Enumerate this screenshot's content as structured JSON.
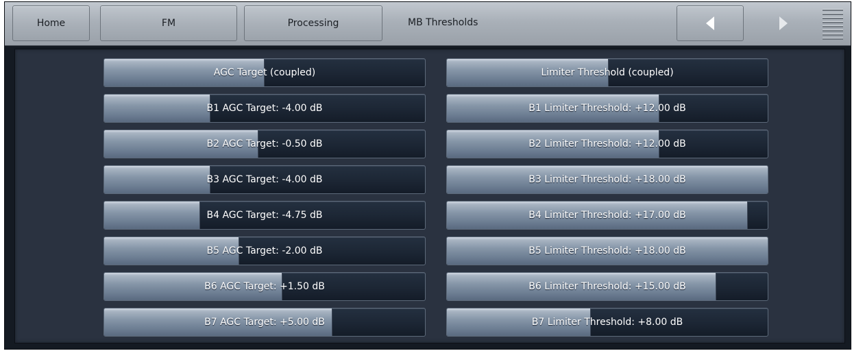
{
  "nav": {
    "home": "Home",
    "fm": "FM",
    "processing": "Processing",
    "page_title": "MB Thresholds",
    "prev_icon": "triangle-left",
    "next_icon": "triangle-right",
    "menu_icon": "hamburger"
  },
  "colors": {
    "frame": "#141a22",
    "panel": "#2a3240",
    "nav_bar": "#a9b0b8",
    "button_fill": "#8696a8",
    "button_track": "#1c2634",
    "text": "#ffffff"
  },
  "agc_buttons": [
    {
      "label": "AGC Target (coupled)",
      "level": 0.497
    },
    {
      "label": "B1 AGC Target: -4.00 dB",
      "level": 0.33
    },
    {
      "label": "B2 AGC Target: -0.50 dB",
      "level": 0.479
    },
    {
      "label": "B3 AGC Target: -4.00 dB",
      "level": 0.33
    },
    {
      "label": "B4 AGC Target: -4.75 dB",
      "level": 0.298
    },
    {
      "label": "B5 AGC Target: -2.00 dB",
      "level": 0.419
    },
    {
      "label": "B6 AGC Target: +1.50 dB",
      "level": 0.553
    },
    {
      "label": "B7 AGC Target: +5.00 dB",
      "level": 0.709
    }
  ],
  "limiter_buttons": [
    {
      "label": "Limiter Threshold (coupled)",
      "level": 0.502
    },
    {
      "label": "B1 Limiter Threshold: +12.00 dB",
      "level": 0.66
    },
    {
      "label": "B2 Limiter Threshold: +12.00 dB",
      "level": 0.66
    },
    {
      "label": "B3 Limiter Threshold: +18.00 dB",
      "level": 1.0
    },
    {
      "label": "B4 Limiter Threshold: +17.00 dB",
      "level": 0.936
    },
    {
      "label": "B5 Limiter Threshold: +18.00 dB",
      "level": 1.0
    },
    {
      "label": "B6 Limiter Threshold: +15.00 dB",
      "level": 0.838
    },
    {
      "label": "B7 Limiter Threshold: +8.00 dB",
      "level": 0.447
    }
  ]
}
